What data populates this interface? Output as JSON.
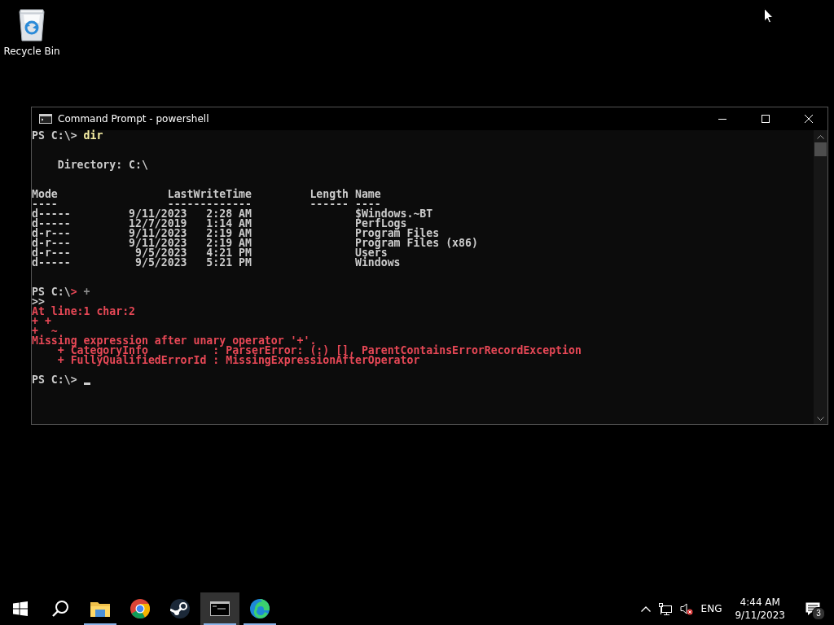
{
  "desktop": {
    "icons": [
      {
        "label": "Recycle Bin"
      }
    ]
  },
  "window": {
    "title": "Command Prompt - powershell",
    "console": {
      "cursor_visible": true,
      "lines": [
        {
          "kind": "text",
          "segments": [
            {
              "kind": "plain",
              "text": "PS C:\\> "
            },
            {
              "kind": "command",
              "text": "dir"
            }
          ]
        },
        {
          "kind": "blank"
        },
        {
          "kind": "blank"
        },
        {
          "kind": "text",
          "segments": [
            {
              "kind": "plain",
              "text": "    Directory: C:\\"
            }
          ]
        },
        {
          "kind": "blank"
        },
        {
          "kind": "blank"
        },
        {
          "kind": "text",
          "segments": [
            {
              "kind": "plain",
              "text": "Mode                 LastWriteTime         Length Name"
            }
          ]
        },
        {
          "kind": "text",
          "segments": [
            {
              "kind": "plain",
              "text": "----                 -------------         ------ ----"
            }
          ]
        },
        {
          "kind": "text",
          "segments": [
            {
              "kind": "plain",
              "text": "d-----         9/11/2023   2:28 AM                $Windows.~BT"
            }
          ]
        },
        {
          "kind": "text",
          "segments": [
            {
              "kind": "plain",
              "text": "d-----         12/7/2019   1:14 AM                PerfLogs"
            }
          ]
        },
        {
          "kind": "text",
          "segments": [
            {
              "kind": "plain",
              "text": "d-r---         9/11/2023   2:19 AM                Program Files"
            }
          ]
        },
        {
          "kind": "text",
          "segments": [
            {
              "kind": "plain",
              "text": "d-r---         9/11/2023   2:19 AM                Program Files (x86)"
            }
          ]
        },
        {
          "kind": "text",
          "segments": [
            {
              "kind": "plain",
              "text": "d-r---          9/5/2023   4:21 PM                Users"
            }
          ]
        },
        {
          "kind": "text",
          "segments": [
            {
              "kind": "plain",
              "text": "d-----          9/5/2023   5:21 PM                Windows"
            }
          ]
        },
        {
          "kind": "blank"
        },
        {
          "kind": "blank"
        },
        {
          "kind": "text",
          "segments": [
            {
              "kind": "plain",
              "text": "PS C:\\"
            },
            {
              "kind": "error",
              "text": ">"
            },
            {
              "kind": "operator",
              "text": " +"
            }
          ]
        },
        {
          "kind": "text",
          "segments": [
            {
              "kind": "plain",
              "text": ">>"
            }
          ]
        },
        {
          "kind": "text",
          "segments": [
            {
              "kind": "error",
              "text": "At line:1 char:2"
            }
          ]
        },
        {
          "kind": "text",
          "segments": [
            {
              "kind": "error",
              "text": "+ +"
            }
          ]
        },
        {
          "kind": "text",
          "segments": [
            {
              "kind": "error",
              "text": "+  ~"
            }
          ]
        },
        {
          "kind": "text",
          "segments": [
            {
              "kind": "error",
              "text": "Missing expression after unary operator '+'."
            }
          ]
        },
        {
          "kind": "text",
          "segments": [
            {
              "kind": "error",
              "text": "    + CategoryInfo          : ParserError: (:) [], ParentContainsErrorRecordException"
            }
          ]
        },
        {
          "kind": "text",
          "segments": [
            {
              "kind": "error",
              "text": "    + FullyQualifiedErrorId : MissingExpressionAfterOperator"
            }
          ]
        },
        {
          "kind": "blank"
        },
        {
          "kind": "text",
          "segments": [
            {
              "kind": "plain",
              "text": "PS C:\\> "
            }
          ]
        }
      ]
    }
  },
  "taskbar": {
    "apps": [
      {
        "kind": "start",
        "running": false,
        "selected": false
      },
      {
        "kind": "search",
        "running": false,
        "selected": false
      },
      {
        "kind": "explorer",
        "running": true,
        "selected": false
      },
      {
        "kind": "chrome",
        "running": false,
        "selected": false
      },
      {
        "kind": "steam",
        "running": false,
        "selected": false
      },
      {
        "kind": "terminal",
        "running": true,
        "selected": true
      },
      {
        "kind": "edge",
        "running": true,
        "selected": false
      }
    ],
    "tray": {
      "language": "ENG",
      "time": "4:44 AM",
      "date": "9/11/2023",
      "notifications": "3"
    }
  }
}
